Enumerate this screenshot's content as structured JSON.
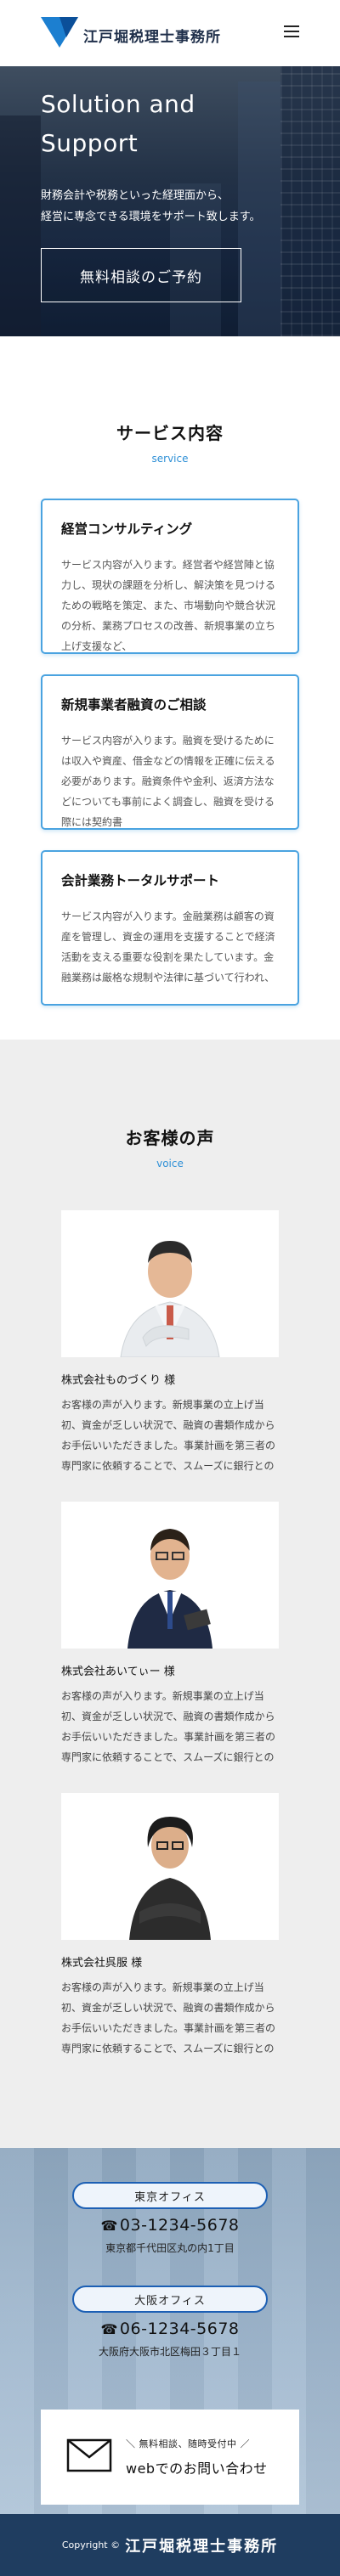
{
  "header": {
    "logo_text": "江戸堀税理士事務所",
    "brand_color": "#1c7fd0",
    "menu_icon": "hamburger-icon"
  },
  "hero": {
    "title_line1": "Solution and",
    "title_line2": "Support",
    "text_line1": "財務会計や税務といった経理面から、",
    "text_line2": "経営に専念できる環境をサポート致します。",
    "cta_label": "無料相談のご予約"
  },
  "services": {
    "title": "サービス内容",
    "subtitle": "service",
    "items": [
      {
        "title": "経営コンサルティング",
        "text": "サービス内容が入ります。経営者や経営陣と協力し、現状の課題を分析し、解決策を見つけるための戦略を策定、また、市場動向や競合状況の分析、業務プロセスの改善、新規事業の立ち上げ支援など、"
      },
      {
        "title": "新規事業者融資のご相談",
        "text": "サービス内容が入ります。融資を受けるためには収入や資産、借金などの情報を正確に伝える必要があります。融資条件や金利、返済方法などについても事前によく調査し、融資を受ける際には契約書"
      },
      {
        "title": "会計業務トータルサポート",
        "text": "サービス内容が入ります。金融業務は顧客の資産を管理し、資金の運用を支援することで経済活動を支える重要な役割を果たしています。金融業務は厳格な規制や法律に基づいて行われ、"
      }
    ]
  },
  "voice": {
    "title": "お客様の声",
    "subtitle": "voice",
    "items": [
      {
        "name": "株式会社ものづくり 様",
        "text": "お客様の声が入ります。新規事業の立上げ当初、資金が乏しい状況で、融資の書類作成からお手伝いいただきました。事業計画を第三者の専門家に依頼することで、スムーズに銀行との"
      },
      {
        "name": "株式会社あいてぃー 様",
        "text": "お客様の声が入ります。新規事業の立上げ当初、資金が乏しい状況で、融資の書類作成からお手伝いいただきました。事業計画を第三者の専門家に依頼することで、スムーズに銀行との"
      },
      {
        "name": "株式会社呉服 様",
        "text": "お客様の声が入ります。新規事業の立上げ当初、資金が乏しい状況で、融資の書類作成からお手伝いいただきました。事業計画を第三者の専門家に依頼することで、スムーズに銀行との"
      }
    ]
  },
  "contact": {
    "offices": [
      {
        "label": "東京オフィス",
        "tel": "03-1234-5678",
        "address": "東京都千代田区丸の内1丁目"
      },
      {
        "label": "大阪オフィス",
        "tel": "06-1234-5678",
        "address": "大阪府大阪市北区梅田３丁目１"
      }
    ],
    "web_small": "＼ 無料相談、随時受付中 ／",
    "web_big": "webでのお問い合わせ"
  },
  "footer": {
    "copyright": "Copyright ©",
    "logo_text": "江戸堀税理士事務所"
  }
}
